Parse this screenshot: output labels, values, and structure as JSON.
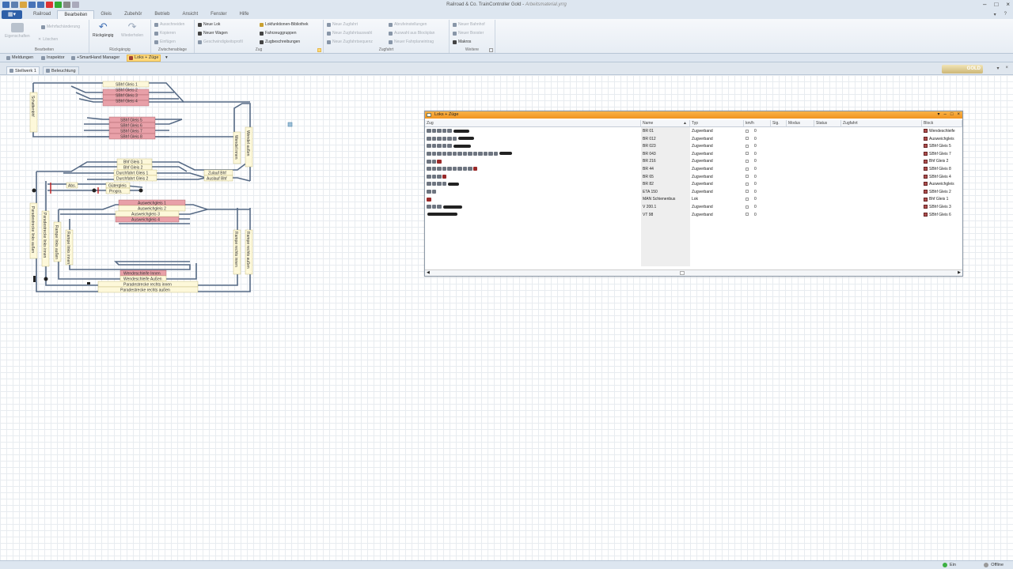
{
  "window": {
    "title_app": "Railroad & Co. TrainController Gold - ",
    "title_doc": "Arbeitsmaterial.yrrg"
  },
  "menu": {
    "tabs": [
      "Railroad",
      "Bearbeiten",
      "Gleis",
      "Zubehör",
      "Betrieb",
      "Ansicht",
      "Fenster",
      "Hilfe"
    ],
    "active_tab": "Bearbeiten"
  },
  "ribbon": {
    "bearbeiten": {
      "label": "Bearbeiten",
      "eigenschaften": "Eigenschaften",
      "mehrfachaenderung": "Mehrfachänderung",
      "loeschen": "Löschen"
    },
    "rueckgaengig": {
      "label": "Rückgängig",
      "undo": "Rückgängig",
      "redo": "Wiederholen"
    },
    "zwischenablage": {
      "label": "Zwischenablage",
      "ausschneiden": "Ausschneiden",
      "kopieren": "Kopieren",
      "einfuegen": "Einfügen"
    },
    "zug": {
      "label": "Zug",
      "neue_lok": "Neue Lok",
      "neuer_wagen": "Neuer Wagen",
      "geschwindigkeitsprofil": "Geschwindigkeitsprofil",
      "lokfunktionen": "Lokfunktionen-Bibliothek",
      "fahrzeuggruppen": "Fahrzeuggruppen",
      "zugbeschreibungen": "Zugbeschreibungen"
    },
    "zugfahrt": {
      "label": "Zugfahrt",
      "neue_zugfahrt": "Neue Zugfahrt",
      "neue_zugfahrtauswahl": "Neue Zugfahrtauswahl",
      "neue_zugfahrtsequenz": "Neue Zugfahrtsequenz",
      "abrufeinstellungen": "Abrufeinstellungen",
      "auswahl_blockplan": "Auswahl aus Blockplan",
      "neuer_fahrplaneintrag": "Neuer Fahrplaneintrag"
    },
    "weitere": {
      "label": "Weitere",
      "neuer_bahnhof": "Neuer Bahnhof",
      "neuer_booster": "Neuer Booster",
      "makros": "Makros"
    }
  },
  "toolbar": {
    "meldungen": "Meldungen",
    "inspektor": "Inspektor",
    "smarthand": "+SmartHand Manager",
    "loks_zuege": "Loks + Züge"
  },
  "doc_tabs": [
    "Stellwerk 1",
    "Beleuchtung"
  ],
  "brand_badge": "GOLD",
  "layout_blocks": {
    "sbhf1": "SBhf Gleis 1",
    "sbhf2": "SBhf Gleis 2",
    "sbhf3": "SBhf Gleis 3",
    "sbhf4": "SBhf Gleis 4",
    "sbhf5": "SBhf Gleis 5",
    "sbhf6": "SBhf Gleis 6",
    "sbhf7": "SBhf Gleis 7",
    "sbhf8": "SBhf Gleis 8",
    "bhf1": "Bhf Gleis 1",
    "bhf2": "Bhf Gleis 2",
    "durchfahrt1": "Durchfahrt Gleis 1",
    "durchfahrt2": "Durchfahrt Gleis 2",
    "zulauf": "Zulauf Bhf",
    "auslauf": "Auslauf Bhf",
    "gueter": "Gütergleis",
    "abs": "Abs.",
    "progra": "Progra.",
    "ausweich1": "Ausweichgleis 1",
    "ausweich2": "Ausweichgleis 2",
    "ausweich3": "Ausweichgleis 3",
    "ausweich4": "Ausweichgleis 4",
    "wendeschleife_innen": "Wendeschleife Innen",
    "wendeschleife_aussen": "Wendeschleife Außen",
    "paradestrecke_innen": "Paradestrecke rechts innen",
    "paradestrecke_aussen": "Paradestrecke rechts außen",
    "wendel_innen": "Wendel innen",
    "wendel_aussen": "Wendel außen",
    "rampe_rechts_aussen": "Rampe rechts außen",
    "rampe_rechts_innen": "Rampe rechts innen",
    "rampe_links_aussen": "Rampe links außen",
    "rampe_links_innen": "Rampe links innen",
    "paradestrecke_links_innen": "Paradestrecke links innen",
    "paradestrecke_links_aussen": "Paradestrecke links außen",
    "schattenbahnhof": "Schattenbhf"
  },
  "locos_window": {
    "title": "Loks + Züge",
    "columns": [
      "Zug",
      "Name",
      "Typ",
      "km/h",
      "Sig.",
      "Modus",
      "Status",
      "Zugfahrt",
      "Block"
    ],
    "rows": [
      {
        "name": "BR 01",
        "typ": "Zugverband",
        "kmh": "0",
        "block": "Wendeschleife",
        "cars": 5,
        "red": 0,
        "smudge": 20
      },
      {
        "name": "BR 012",
        "typ": "Zugverband",
        "kmh": "0",
        "block": "Ausweichgleis",
        "cars": 6,
        "red": 0,
        "smudge": 20
      },
      {
        "name": "BR 023",
        "typ": "Zugverband",
        "kmh": "0",
        "block": "SBhf Gleis 5",
        "cars": 5,
        "red": 0,
        "smudge": 22
      },
      {
        "name": "BR 043",
        "typ": "Zugverband",
        "kmh": "0",
        "block": "SBhf Gleis 7",
        "cars": 14,
        "red": 0,
        "smudge": 16
      },
      {
        "name": "BR 216",
        "typ": "Zugverband",
        "kmh": "0",
        "block": "Bhf Gleis 2",
        "cars": 2,
        "red": 1,
        "smudge": 0
      },
      {
        "name": "BR 44",
        "typ": "Zugverband",
        "kmh": "0",
        "block": "SBhf Gleis 8",
        "cars": 9,
        "red": 1,
        "smudge": 0
      },
      {
        "name": "BR 65",
        "typ": "Zugverband",
        "kmh": "0",
        "block": "SBhf Gleis 4",
        "cars": 3,
        "red": 1,
        "smudge": 0
      },
      {
        "name": "BR 82",
        "typ": "Zugverband",
        "kmh": "0",
        "block": "Ausweichgleis",
        "cars": 4,
        "red": 0,
        "smudge": 14
      },
      {
        "name": "ETA 150",
        "typ": "Zugverband",
        "kmh": "0",
        "block": "SBhf Gleis 2",
        "cars": 2,
        "red": 0,
        "smudge": 0
      },
      {
        "name": "MAN Schienenbus",
        "typ": "Lok",
        "kmh": "0",
        "block": "Bhf Gleis 1",
        "cars": 0,
        "red": 1,
        "smudge": 0
      },
      {
        "name": "V 200.1",
        "typ": "Zugverband",
        "kmh": "0",
        "block": "SBhf Gleis 3",
        "cars": 3,
        "red": 0,
        "smudge": 24
      },
      {
        "name": "VT 98",
        "typ": "Zugverband",
        "kmh": "0",
        "block": "SBhf Gleis 6",
        "cars": 0,
        "red": 0,
        "smudge": 38
      }
    ]
  },
  "status": {
    "ein": "Ein",
    "offline": "Offline"
  },
  "colors": {
    "accent_orange": "#f19420",
    "track": "#566a85",
    "occupied": "#e8a0a8",
    "block_fill": "#fdf8da"
  }
}
